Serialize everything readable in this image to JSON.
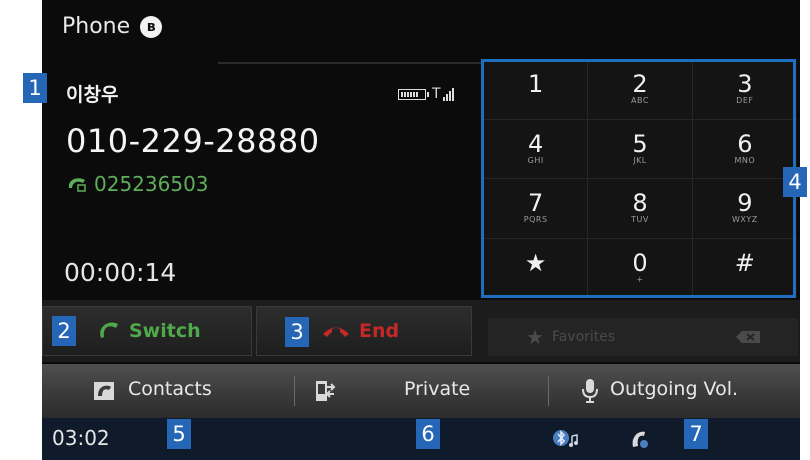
{
  "app": {
    "title": "Phone"
  },
  "call": {
    "caller_name": "이창우",
    "number": "010-229-28880",
    "alt_number": "025236503",
    "duration": "00:00:14"
  },
  "keypad": {
    "keys": [
      {
        "digit": "1",
        "letters": ""
      },
      {
        "digit": "2",
        "letters": "ABC"
      },
      {
        "digit": "3",
        "letters": "DEF"
      },
      {
        "digit": "4",
        "letters": "GHI"
      },
      {
        "digit": "5",
        "letters": "JKL"
      },
      {
        "digit": "6",
        "letters": "MNO"
      },
      {
        "digit": "7",
        "letters": "PQRS"
      },
      {
        "digit": "8",
        "letters": "TUV"
      },
      {
        "digit": "9",
        "letters": "WXYZ"
      },
      {
        "digit": "★",
        "letters": ""
      },
      {
        "digit": "0",
        "letters": "+"
      },
      {
        "digit": "#",
        "letters": ""
      }
    ]
  },
  "actions": {
    "switch_label": "Switch",
    "end_label": "End",
    "favorites_label": "Favorites"
  },
  "menu": {
    "contacts_label": "Contacts",
    "private_label": "Private",
    "outgoing_vol_label": "Outgoing Vol."
  },
  "statusbar": {
    "clock": "03:02"
  },
  "callouts": [
    "1",
    "2",
    "3",
    "4",
    "5",
    "6",
    "7"
  ],
  "colors": {
    "callout_bg": "#2566b6",
    "switch_green": "#4fa84a",
    "end_red": "#c62828",
    "alt_number_green": "#5fae5a"
  }
}
